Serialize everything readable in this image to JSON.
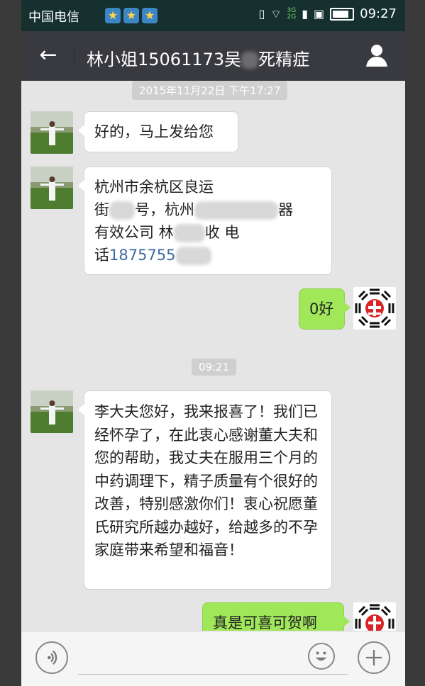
{
  "status_bar": {
    "carrier": "中国电信",
    "time": "09:27",
    "network_top": "3G",
    "network_bottom": "2G"
  },
  "header": {
    "title_part1": "林小姐15061173吴",
    "title_part2": "死精症"
  },
  "messages": [
    {
      "type": "time",
      "text": "2015年11月22日 下午17:27"
    },
    {
      "type": "left",
      "text": "好的，马上发给您"
    },
    {
      "type": "left",
      "line1": "杭州市余杭区良运",
      "line2_a": "街",
      "line2_b": "号，杭州",
      "line2_c": "器",
      "line3_a": "有效公司 林",
      "line3_b": "收 电",
      "line4_a": "话",
      "line4_phone": "1875755"
    },
    {
      "type": "right",
      "text": "0好"
    },
    {
      "type": "time",
      "text": "09:21"
    },
    {
      "type": "left",
      "text": "李大夫您好，我来报喜了！我们已经怀孕了，在此衷心感谢董大夫和您的帮助，我丈夫在服用三个月的中药调理下，精子质量有个很好的改善，特别感激你们！衷心祝愿董氏研究所越办越好，给越多的不孕家庭带来希望和福音！"
    },
    {
      "type": "right",
      "text": "真是可喜可贺啊"
    }
  ],
  "icons": {
    "back": "back-arrow-icon",
    "profile": "person-icon",
    "voice": "voice-icon",
    "emoji": "emoji-icon",
    "plus": "plus-icon"
  }
}
